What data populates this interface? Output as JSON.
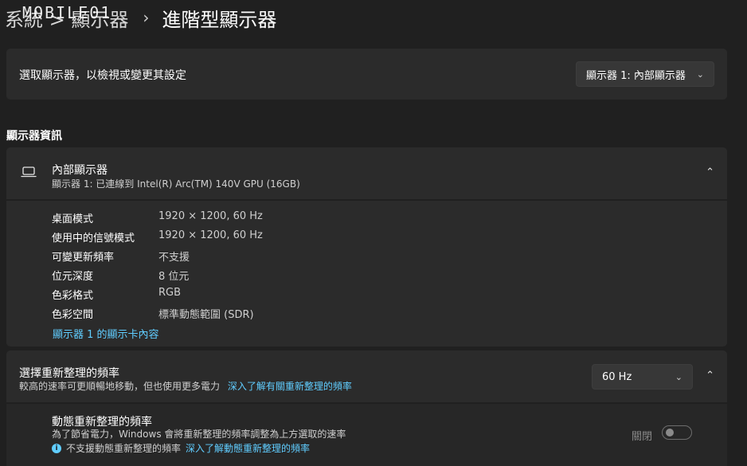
{
  "breadcrumb": {
    "prev": "系統 > 顯示器",
    "sep": "›",
    "current": "進階型顯示器"
  },
  "watermark": "MOBILE01",
  "select_display": {
    "label": "選取顯示器，以檢視或變更其設定",
    "value": "顯示器 1: 內部顯示器",
    "icon": "chevron-down-icon"
  },
  "section_title": "顯示器資訊",
  "display": {
    "icon": "laptop-icon",
    "title": "內部顯示器",
    "subtitle": "顯示器 1: 已連線到 Intel(R) Arc(TM) 140V GPU (16GB)",
    "expander_icon": "chevron-up-icon",
    "info": [
      {
        "key": "桌面模式",
        "value": "1920 × 1200, 60 Hz"
      },
      {
        "key": "使用中的信號模式",
        "value": "1920 × 1200, 60 Hz"
      },
      {
        "key": "可變更新頻率",
        "value": "不支援"
      },
      {
        "key": "位元深度",
        "value": "8 位元"
      },
      {
        "key": "色彩格式",
        "value": "RGB"
      },
      {
        "key": "色彩空間",
        "value": "標準動態範圍 (SDR)"
      }
    ],
    "adapter_link": "顯示器 1 的顯示卡內容"
  },
  "refresh": {
    "title": "選擇重新整理的頻率",
    "subtitle": "較高的速率可更順暢地移動，但也使用更多電力",
    "learn_link": "深入了解有關重新整理的頻率",
    "value": "60 Hz",
    "expander_icon": "chevron-up-icon"
  },
  "dynamic": {
    "title": "動態重新整理的頻率",
    "subtitle": "為了節省電力，Windows 會將重新整理的頻率調整為上方選取的速率",
    "note": "不支援動態重新整理的頻率",
    "note_link": "深入了解動態重新整理的頻率",
    "toggle_label": "關閉",
    "toggle_on": false
  },
  "colors": {
    "accent": "#60cdff",
    "background": "#202020",
    "card": "#2b2b2b"
  }
}
